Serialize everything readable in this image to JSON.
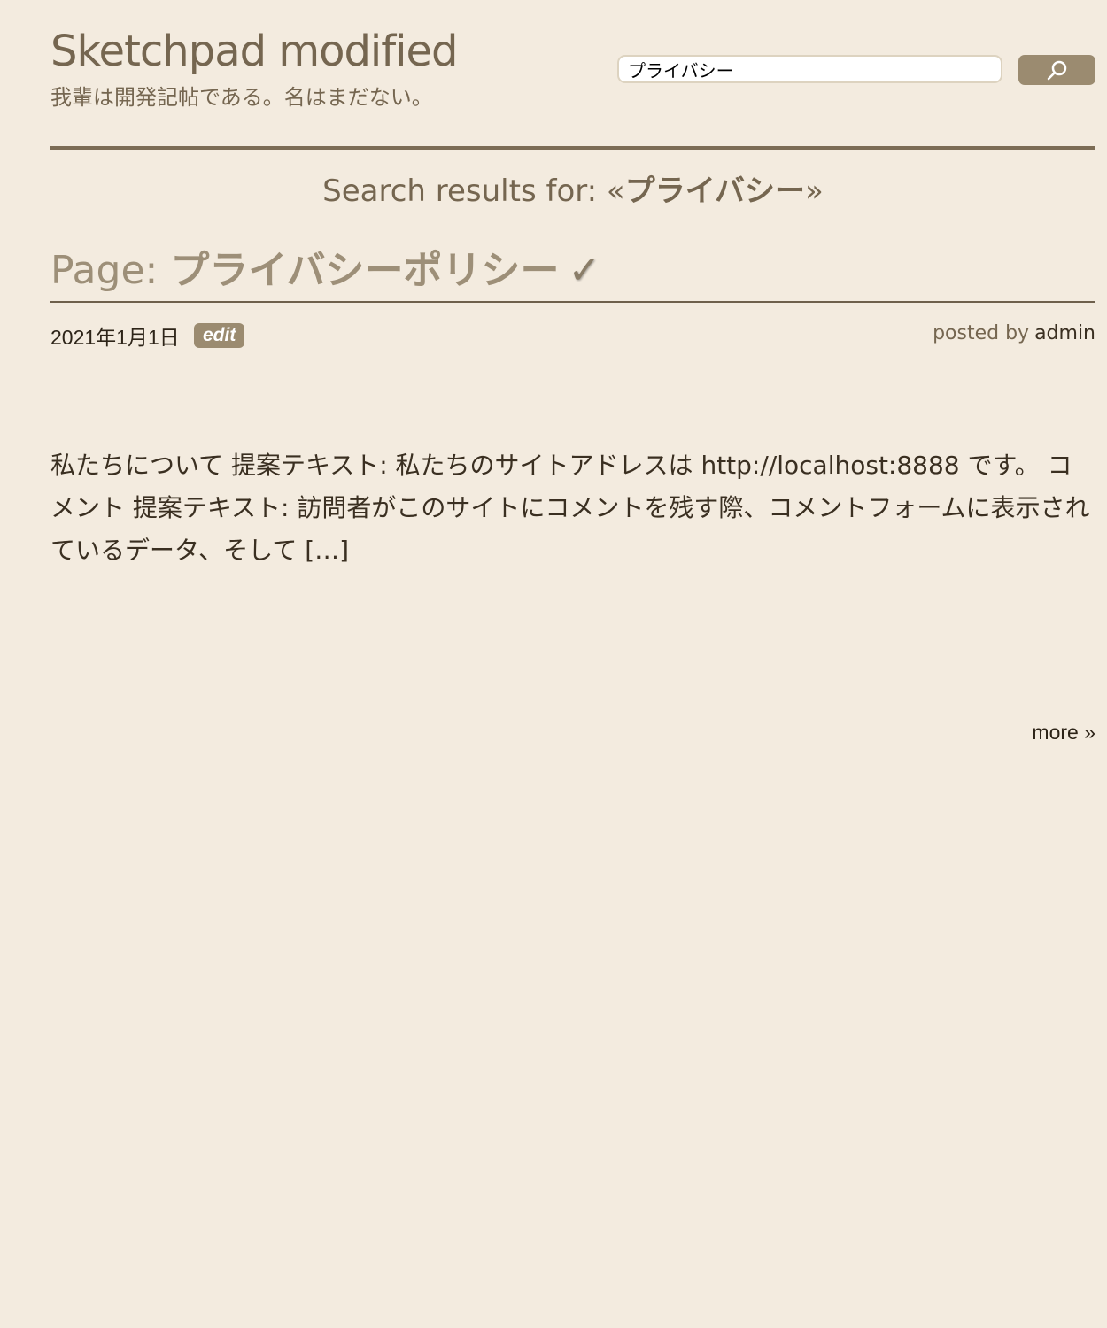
{
  "site": {
    "title": "Sketchpad modified",
    "tagline": "我輩は開発記帖である。名はまだない。"
  },
  "search": {
    "value": "プライバシー",
    "button_icon": "search-icon"
  },
  "results_heading": {
    "prefix": "Search results for: «",
    "query": "プライバシー",
    "suffix": "»"
  },
  "result": {
    "type_label": "Page: ",
    "title": "プライバシーポリシー",
    "check_glyph": "✓",
    "date": "2021年1月1日",
    "edit_label": "edit",
    "posted_by_label": "posted by",
    "author": "admin",
    "excerpt": "私たちについて 提案テキスト: 私たちのサイトアドレスは http://localhost:8888 です。 コメント 提案テキスト: 訪問者がこのサイトにコメントを残す際、コメントフォームに表示されているデータ、そして […]",
    "more_label": "more »"
  },
  "colors": {
    "background": "#f3ebdf",
    "accent": "#9b8b70",
    "heading": "#756650",
    "text": "#3a2f21"
  }
}
